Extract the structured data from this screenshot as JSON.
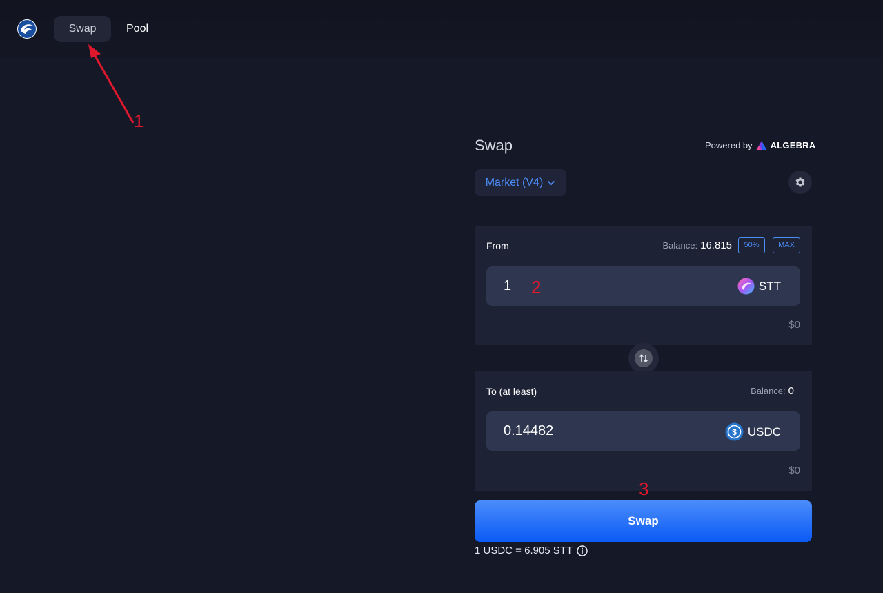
{
  "nav": {
    "swap_label": "Swap",
    "pool_label": "Pool"
  },
  "annotations": {
    "one": "1",
    "two": "2",
    "three": "3",
    "color": "#e0182d"
  },
  "panel": {
    "title": "Swap",
    "powered_by": "Powered by",
    "brand": "ALGEBRA",
    "market_label": "Market (V4)"
  },
  "from": {
    "label": "From",
    "balance_label": "Balance:",
    "balance_value": "16.815",
    "pct_label": "50%",
    "max_label": "MAX",
    "amount": "1",
    "token": "STT",
    "usd": "$0"
  },
  "to": {
    "label": "To (at least)",
    "balance_label": "Balance:",
    "balance_value": "0",
    "amount": "0.14482",
    "token": "USDC",
    "usd": "$0"
  },
  "swap_button": "Swap",
  "rate": "1 USDC = 6.905 STT",
  "colors": {
    "accent": "#4d8df8",
    "background": "#151827",
    "card": "#1d2235",
    "input": "#2e3650"
  }
}
